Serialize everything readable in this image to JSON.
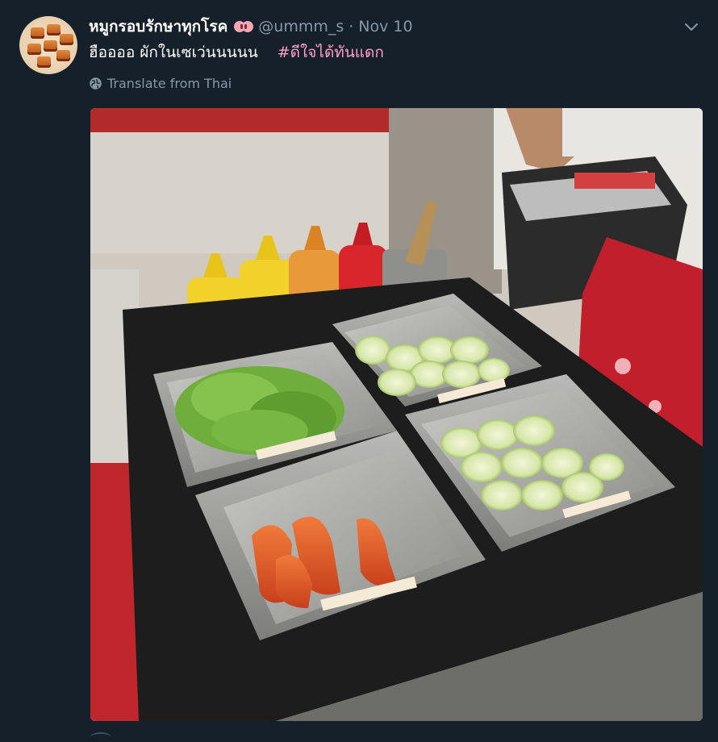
{
  "tweet": {
    "display_name": "หมูกรอบรักษาทุกโรค",
    "handle": "@ummm_s",
    "separator": "·",
    "date": "Nov 10",
    "text": "ฮืออออ ผักในเซเว่นนนนน",
    "hashtag": "#ดีใจได้ทันแดก",
    "translate_label": "Translate from Thai"
  },
  "icons": {
    "avatar": "crispy-pork-avatar",
    "name_emoji": "pill-icon",
    "chevron": "chevron-down-icon",
    "translate": "globe-icon"
  },
  "colors": {
    "background": "#15202b",
    "text_primary": "#ffffff",
    "text_secondary": "#8899a6",
    "hashtag": "#ff9ec7"
  }
}
